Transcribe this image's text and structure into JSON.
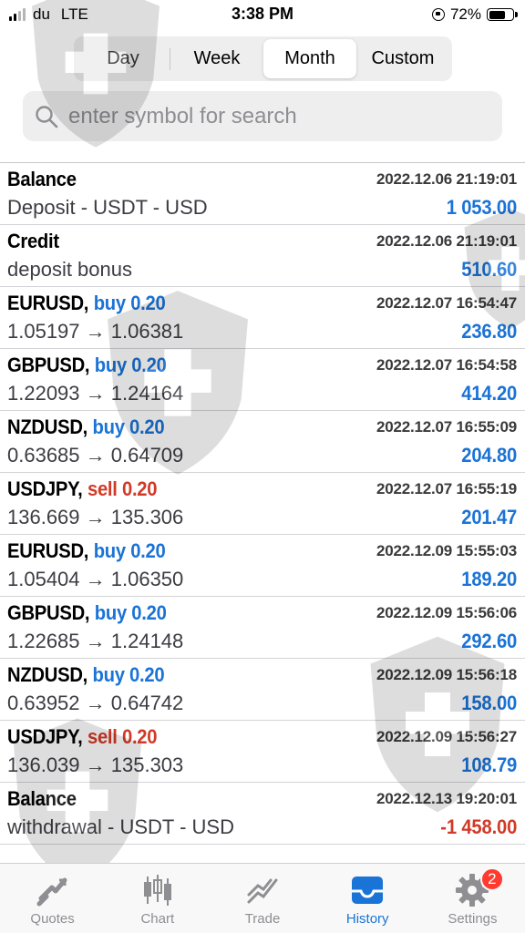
{
  "status_bar": {
    "carrier": "du",
    "network": "LTE",
    "time": "3:38 PM",
    "battery": "72%",
    "battery_level": 0.72
  },
  "period_tabs": [
    {
      "label": "Day",
      "active": false
    },
    {
      "label": "Week",
      "active": false
    },
    {
      "label": "Month",
      "active": true
    },
    {
      "label": "Custom",
      "active": false
    }
  ],
  "search": {
    "placeholder": "enter symbol for search"
  },
  "deals": [
    {
      "symbol": "Balance",
      "side": "",
      "side_label": "",
      "datetime": "2022.12.06 21:19:01",
      "detail": "Deposit - USDT - USD",
      "amount": "1 053.00",
      "amount_sign": "pos"
    },
    {
      "symbol": "Credit",
      "side": "",
      "side_label": "",
      "datetime": "2022.12.06 21:19:01",
      "detail": "deposit bonus",
      "amount": "510.60",
      "amount_sign": "pos"
    },
    {
      "symbol": "EURUSD,",
      "side": "buy",
      "side_label": "buy 0.20",
      "datetime": "2022.12.07 16:54:47",
      "detail": "1.05197 → 1.06381",
      "amount": "236.80",
      "amount_sign": "pos"
    },
    {
      "symbol": "GBPUSD,",
      "side": "buy",
      "side_label": "buy 0.20",
      "datetime": "2022.12.07 16:54:58",
      "detail": "1.22093 → 1.24164",
      "amount": "414.20",
      "amount_sign": "pos"
    },
    {
      "symbol": "NZDUSD,",
      "side": "buy",
      "side_label": "buy 0.20",
      "datetime": "2022.12.07 16:55:09",
      "detail": "0.63685 → 0.64709",
      "amount": "204.80",
      "amount_sign": "pos"
    },
    {
      "symbol": "USDJPY,",
      "side": "sell",
      "side_label": "sell 0.20",
      "datetime": "2022.12.07 16:55:19",
      "detail": "136.669 → 135.306",
      "amount": "201.47",
      "amount_sign": "pos"
    },
    {
      "symbol": "EURUSD,",
      "side": "buy",
      "side_label": "buy 0.20",
      "datetime": "2022.12.09 15:55:03",
      "detail": "1.05404 → 1.06350",
      "amount": "189.20",
      "amount_sign": "pos"
    },
    {
      "symbol": "GBPUSD,",
      "side": "buy",
      "side_label": "buy 0.20",
      "datetime": "2022.12.09 15:56:06",
      "detail": "1.22685 → 1.24148",
      "amount": "292.60",
      "amount_sign": "pos"
    },
    {
      "symbol": "NZDUSD,",
      "side": "buy",
      "side_label": "buy 0.20",
      "datetime": "2022.12.09 15:56:18",
      "detail": "0.63952 → 0.64742",
      "amount": "158.00",
      "amount_sign": "pos"
    },
    {
      "symbol": "USDJPY,",
      "side": "sell",
      "side_label": "sell 0.20",
      "datetime": "2022.12.09 15:56:27",
      "detail": "136.039 → 135.303",
      "amount": "108.79",
      "amount_sign": "pos"
    },
    {
      "symbol": "Balance",
      "side": "",
      "side_label": "",
      "datetime": "2022.12.13 19:20:01",
      "detail": "withdrawal - USDT - USD",
      "amount": "-1 458.00",
      "amount_sign": "neg"
    }
  ],
  "tabbar": [
    {
      "label": "Quotes",
      "icon": "quotes-icon",
      "active": false
    },
    {
      "label": "Chart",
      "icon": "candlestick-icon",
      "active": false
    },
    {
      "label": "Trade",
      "icon": "trade-icon",
      "active": false
    },
    {
      "label": "History",
      "icon": "inbox-icon",
      "active": true
    },
    {
      "label": "Settings",
      "icon": "gear-icon",
      "active": false,
      "badge": "2"
    }
  ],
  "colors": {
    "accent": "#1a73d6",
    "sell": "#d23a27",
    "badge": "#ff3b30"
  }
}
